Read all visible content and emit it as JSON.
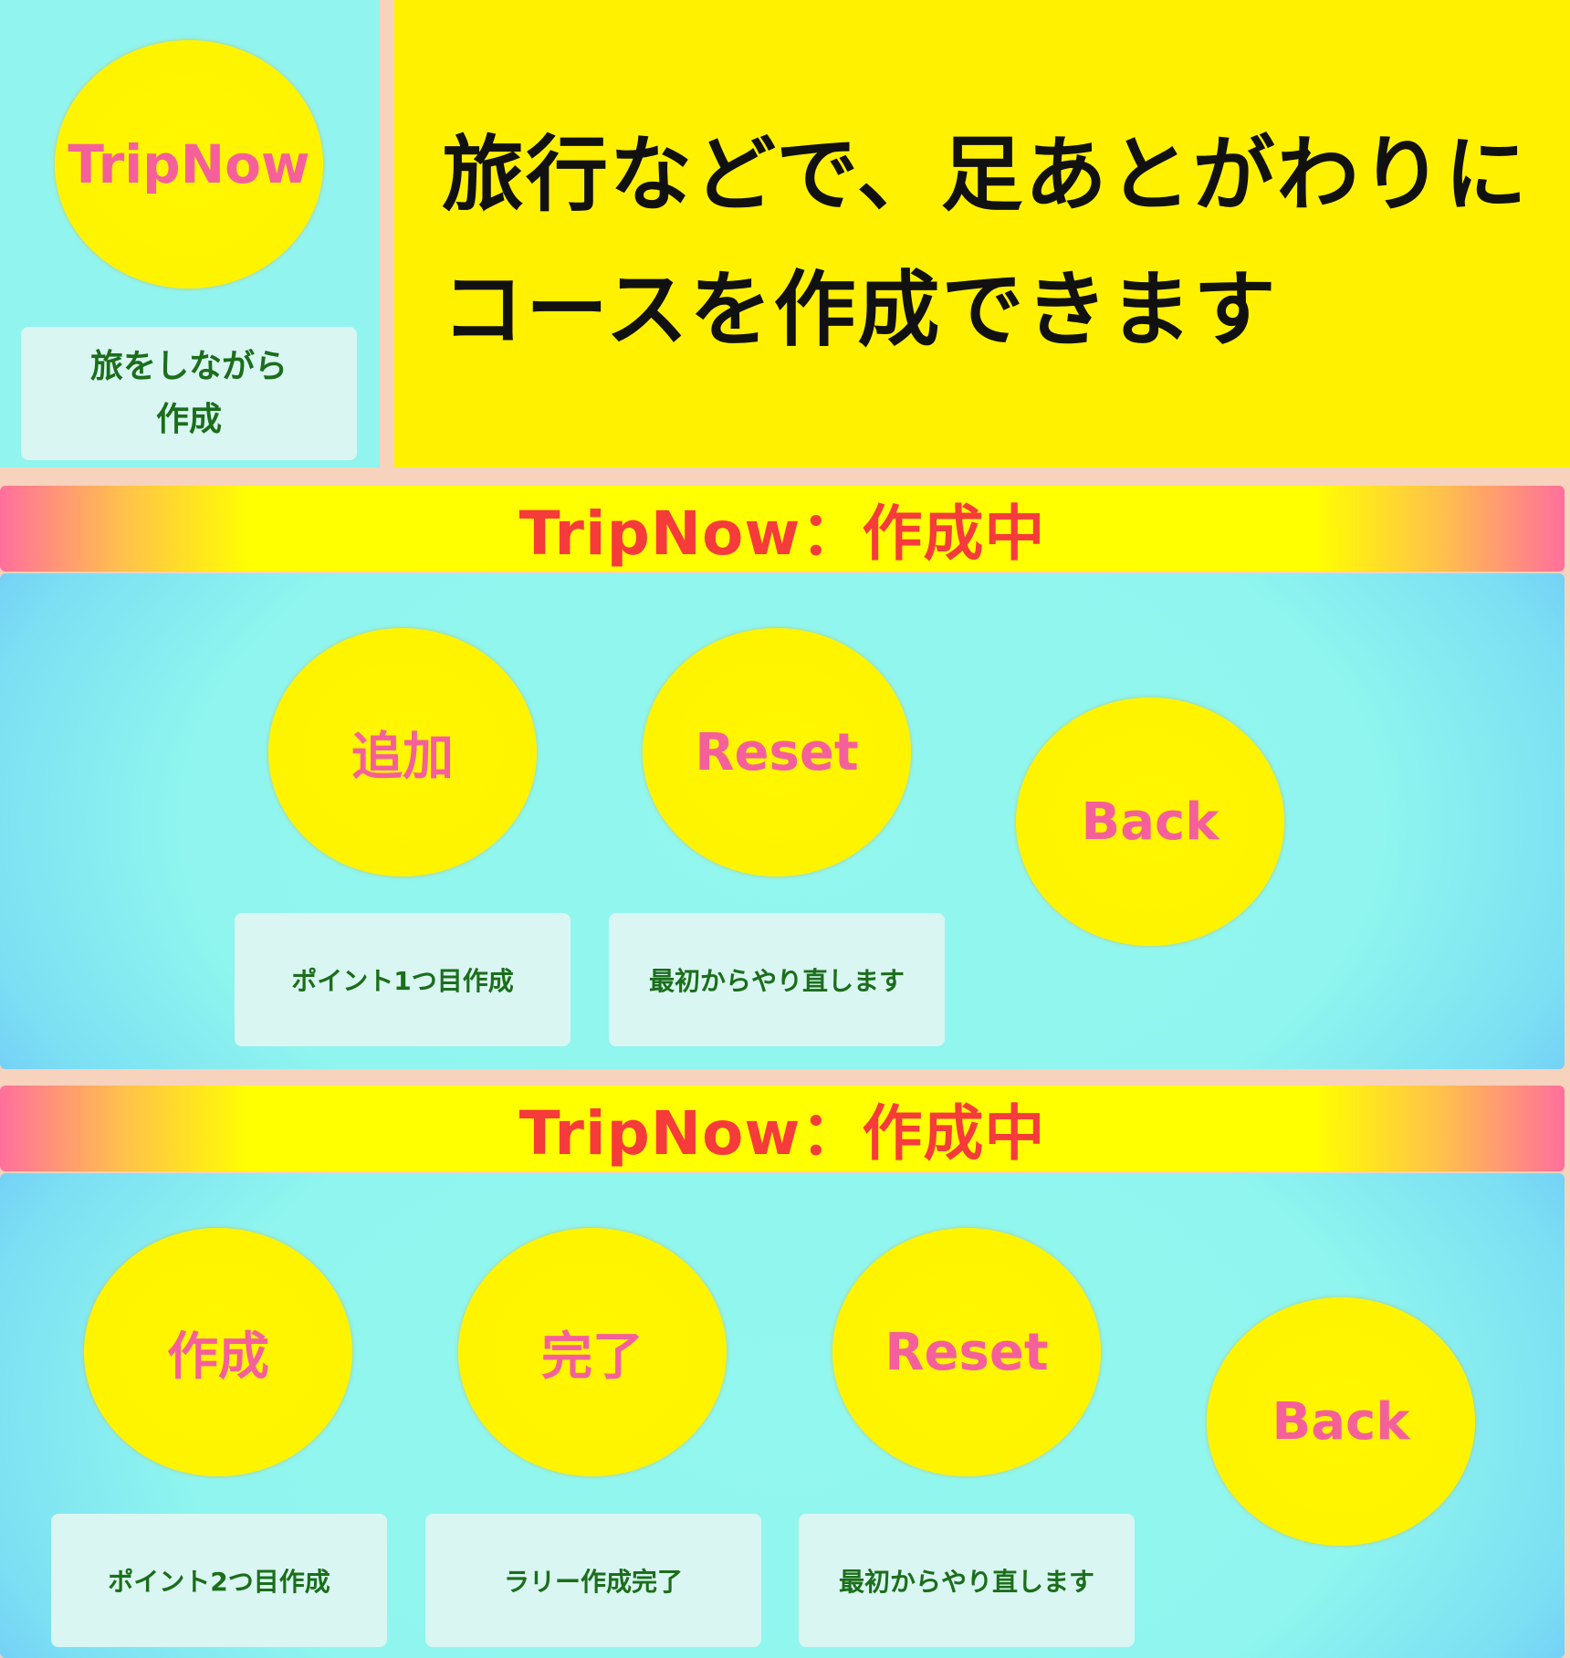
{
  "hero": {
    "logo_label": "TripNow",
    "caption": "旅をしながら作成",
    "caption_line1": "旅をしながら",
    "caption_line2": "作成",
    "headline_line1": "旅行などで、足あとがわりに",
    "headline_line2": "コースを作成できます"
  },
  "section1": {
    "banner": "TripNow：作成中",
    "buttons": [
      {
        "label": "追加",
        "caption": "ポイント1つ目作成"
      },
      {
        "label": "Reset",
        "caption": "最初からやり直します"
      },
      {
        "label": "Back"
      }
    ]
  },
  "section2": {
    "banner": "TripNow：作成中",
    "buttons": [
      {
        "label": "作成",
        "caption": "ポイント2つ目作成"
      },
      {
        "label": "完了",
        "caption": "ラリー作成完了"
      },
      {
        "label": "Reset",
        "caption": "最初からやり直します"
      },
      {
        "label": "Back"
      }
    ]
  },
  "colors": {
    "panel_cyan": "#92f4ee",
    "hero_yellow": "#fff100",
    "button_yellow": "#fff600",
    "button_text_pink": "#f5609a",
    "banner_text_red": "#f63b3b",
    "caption_text_green": "#1b6e1b",
    "caption_card_bg": "#d9f6f2",
    "page_bg_peach": "#f7d2bd"
  }
}
